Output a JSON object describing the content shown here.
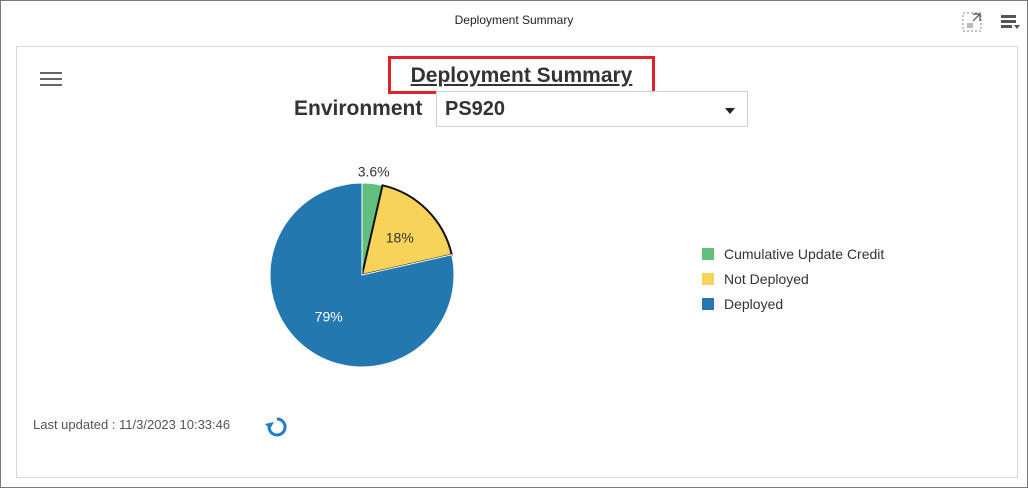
{
  "window": {
    "title": "Deployment Summary"
  },
  "header": {
    "title": "Deployment Summary"
  },
  "environment": {
    "label": "Environment",
    "selected": "PS920"
  },
  "footer": {
    "last_updated": "Last updated : 11/3/2023 10:33:46"
  },
  "icons": {
    "expand": "expand-icon",
    "options": "options-menu-icon",
    "hamburger": "hamburger-menu-icon",
    "refresh": "refresh-icon",
    "dropdown": "chevron-down-icon"
  },
  "chart_data": {
    "type": "pie",
    "title": "Deployment Summary",
    "slices": [
      {
        "name": "Cumulative Update Credit",
        "value": 3.6,
        "label": "3.6%",
        "color": "#62c07e"
      },
      {
        "name": "Not Deployed",
        "value": 18,
        "label": "18%",
        "color": "#f8d35a"
      },
      {
        "name": "Deployed",
        "value": 79,
        "label": "79%",
        "color": "#2478b0"
      }
    ],
    "highlighted_slice": "Not Deployed",
    "legend_position": "right"
  }
}
